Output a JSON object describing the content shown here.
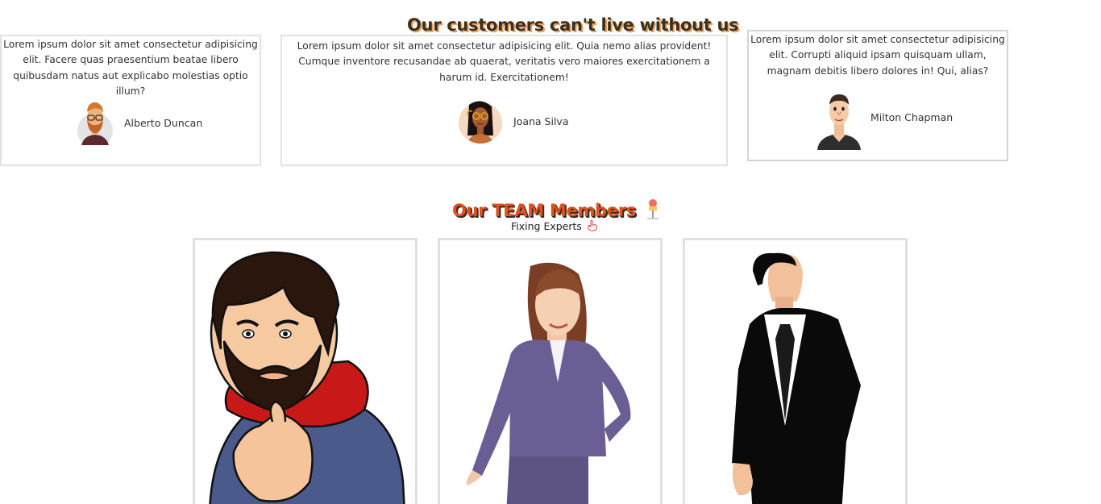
{
  "customers_section": {
    "title": "Our customers can't live without us",
    "testimonials": [
      {
        "quote": "Lorem ipsum dolor sit amet consectetur adipisicing elit. Facere quas praesentium beatae libero quibusdam natus aut explicabo molestias optio illum?",
        "name": "Alberto Duncan",
        "avatar": "bearded-man-glasses-avatar"
      },
      {
        "quote": "Lorem ipsum dolor sit amet consectetur adipisicing elit. Quia nemo alias provident! Cumque inventore recusandae ab quaerat, veritatis vero maiores exercitationem a harum id. Exercitationem!",
        "name": "Joana Silva",
        "avatar": "woman-sunglasses-avatar"
      },
      {
        "quote": "Lorem ipsum dolor sit amet consectetur adipisicing elit. Corrupti aliquid ipsam quisquam ullam, magnam debitis libero dolores in! Qui, alias?",
        "name": "Milton Chapman",
        "avatar": "young-man-avatar"
      }
    ]
  },
  "team_section": {
    "title": "Our TEAM Members",
    "title_icon": "ice-cream-icon",
    "subtitle": "Fixing Experts",
    "subtitle_icon": "pointing-hand-icon",
    "members": [
      {
        "image": "bearded-man-pointing-illustration"
      },
      {
        "image": "businesswoman-illustration"
      },
      {
        "image": "businessman-suit-illustration"
      }
    ]
  },
  "colors": {
    "customers_title": "#3a3020",
    "customers_title_shadow": "#f0a05a",
    "team_title": "#e05020",
    "card_border": "#e2e2e2"
  }
}
